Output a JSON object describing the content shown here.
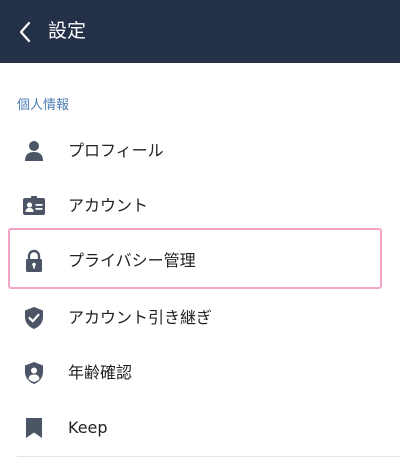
{
  "header": {
    "title": "設定",
    "background": "#253049"
  },
  "section": {
    "title": "個人情報",
    "color": "#4d7db1"
  },
  "items": [
    {
      "label": "プロフィール",
      "icon": "person-icon"
    },
    {
      "label": "アカウント",
      "icon": "id-card-icon"
    },
    {
      "label": "プライバシー管理",
      "icon": "lock-icon",
      "highlighted": true
    },
    {
      "label": "アカウント引き継ぎ",
      "icon": "shield-check-icon"
    },
    {
      "label": "年齢確認",
      "icon": "shield-person-icon"
    },
    {
      "label": "Keep",
      "icon": "bookmark-icon"
    }
  ],
  "colors": {
    "icon": "#4b5566",
    "highlight_border": "#f2a5c6"
  }
}
